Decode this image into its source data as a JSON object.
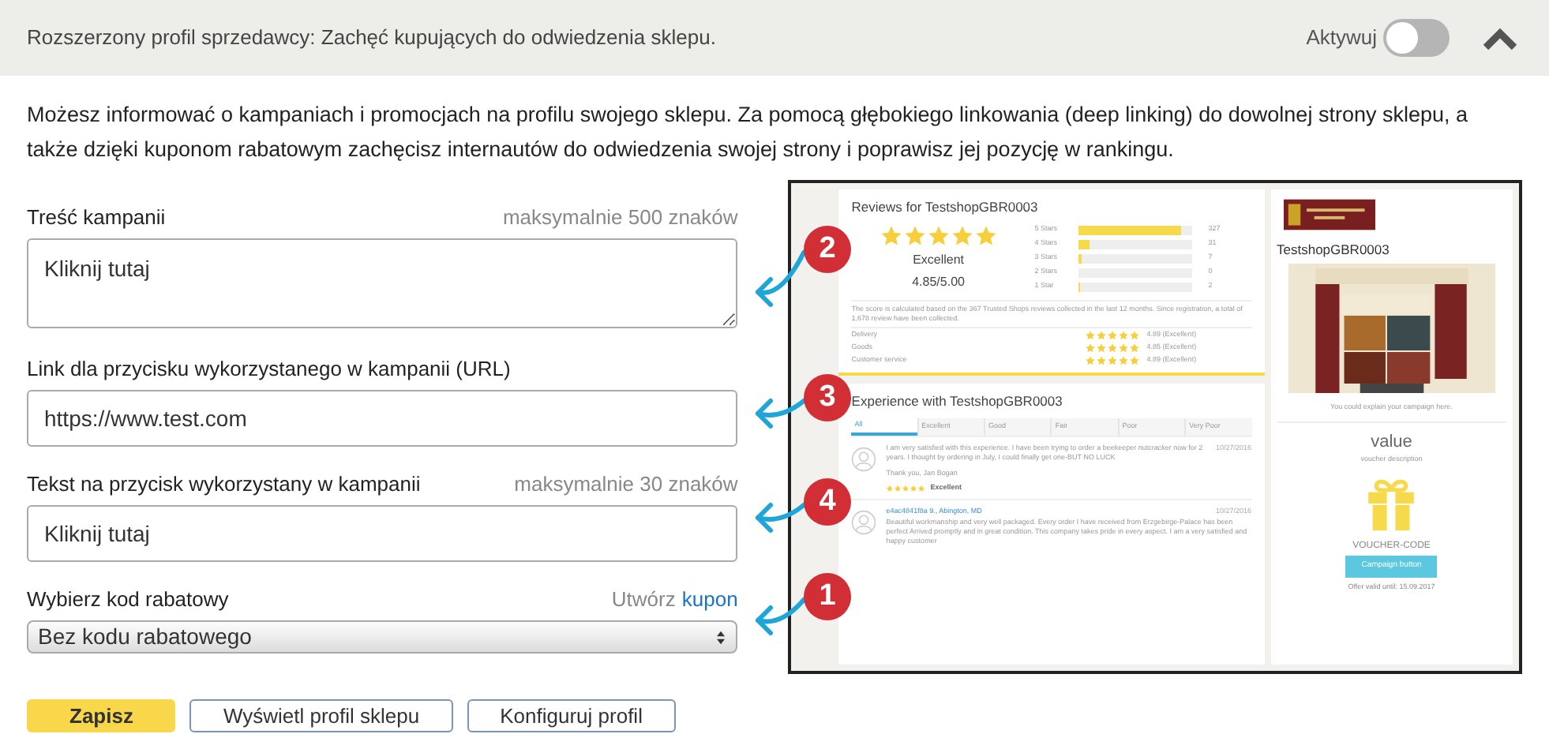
{
  "header": {
    "title": "Rozszerzony profil sprzedawcy: Zachęć kupujących do odwiedzenia sklepu.",
    "toggle_label": "Aktywuj",
    "toggle_on": false
  },
  "intro": "Możesz informować o kampaniach i promocjach na profilu swojego sklepu. Za pomocą głębokiego linkowania (deep linking) do dowolnej strony sklepu, a także dzięki kuponom rabatowym zachęcisz internautów do odwiedzenia swojej strony i poprawisz jej pozycję w rankingu.",
  "fields": [
    {
      "kind": "textarea",
      "label": "Treść kampanii",
      "hint": "maksymalnie 500 znaków",
      "value": "Kliknij tutaj",
      "callout": "2"
    },
    {
      "kind": "input",
      "label": "Link dla przycisku wykorzystanego w kampanii (URL)",
      "value": "https://www.test.com",
      "callout": "3"
    },
    {
      "kind": "input",
      "label": "Tekst na przycisk wykorzystany w kampanii",
      "hint": "maksymalnie 30 znaków",
      "value": "Kliknij tutaj",
      "callout": "4"
    },
    {
      "kind": "select",
      "label": "Wybierz kod rabatowy",
      "link_prefix": "Utwórz",
      "link": "kupon",
      "value": "Bez kodu rabatowego",
      "callout": "1"
    }
  ],
  "buttons": [
    {
      "label": "Zapisz",
      "primary": true
    },
    {
      "label": "Wyświetl profil sklepu",
      "primary": false
    },
    {
      "label": "Konfiguruj profil",
      "primary": false
    }
  ],
  "preview": {
    "reviews_title": "Reviews for TestshopGBR0003",
    "stars": 5,
    "rating_word": "Excellent",
    "score": "4.85/5.00",
    "distribution": [
      {
        "label": "5 Stars",
        "level": 0.9,
        "count": "327"
      },
      {
        "label": "4 Stars",
        "level": 0.09,
        "count": "31"
      },
      {
        "label": "3 Stars",
        "level": 0.02,
        "count": "7"
      },
      {
        "label": "2 Stars",
        "level": 0,
        "count": "0"
      },
      {
        "label": "1 Star",
        "level": 0.01,
        "count": "2"
      }
    ],
    "score_note": "The score is calculated based on the 367 Trusted Shops reviews collected in the last 12 months. Since registration, a total of 1,678 review have been collected.",
    "criteria": [
      {
        "label": "Delivery",
        "stars": 5,
        "value": "4.89 (Excellent)"
      },
      {
        "label": "Goods",
        "stars": 5,
        "value": "4.85 (Excellent)"
      },
      {
        "label": "Customer service",
        "stars": 5,
        "value": "4.89 (Excellent)"
      }
    ],
    "experience_title": "Experience with TestshopGBR0003",
    "filters": [
      {
        "label": "All",
        "selected": true
      },
      {
        "label": "Excellent",
        "selected": false
      },
      {
        "label": "Good",
        "selected": false
      },
      {
        "label": "Fair",
        "selected": false
      },
      {
        "label": "Poor",
        "selected": false
      },
      {
        "label": "Very Poor",
        "selected": false
      }
    ],
    "reviews": [
      {
        "text": "I am very satisfied with this experience. I have been trying to order a beekeeper nutcracker now for 2 years. I thought by ordering in July, I could finally get one-BUT NO LUCK",
        "date": "10/27/2016",
        "signoff": "Thank you, Jan Bogan",
        "stars": 5,
        "rating": "Excellent"
      },
      {
        "author": "e4ac4841f8a 9., Abington, MD",
        "date": "10/27/2016",
        "text": "Beautiful workmanship and very well packaged. Every order I have received from Erzgebirge-Palace has been perfect Arrived promptly and in great condition. This company takes pride in every aspect. I am a very satisfied and happy customer"
      }
    ],
    "shop_name": "TestshopGBR0003",
    "campaign_text": "You could explain your campaign here.",
    "voucher_value": "value",
    "voucher_description": "voucher description",
    "voucher_code": "VOUCHER-CODE",
    "campaign_button": "Campaign button",
    "offer_valid": "Offer valid until: 15.09.2017"
  }
}
